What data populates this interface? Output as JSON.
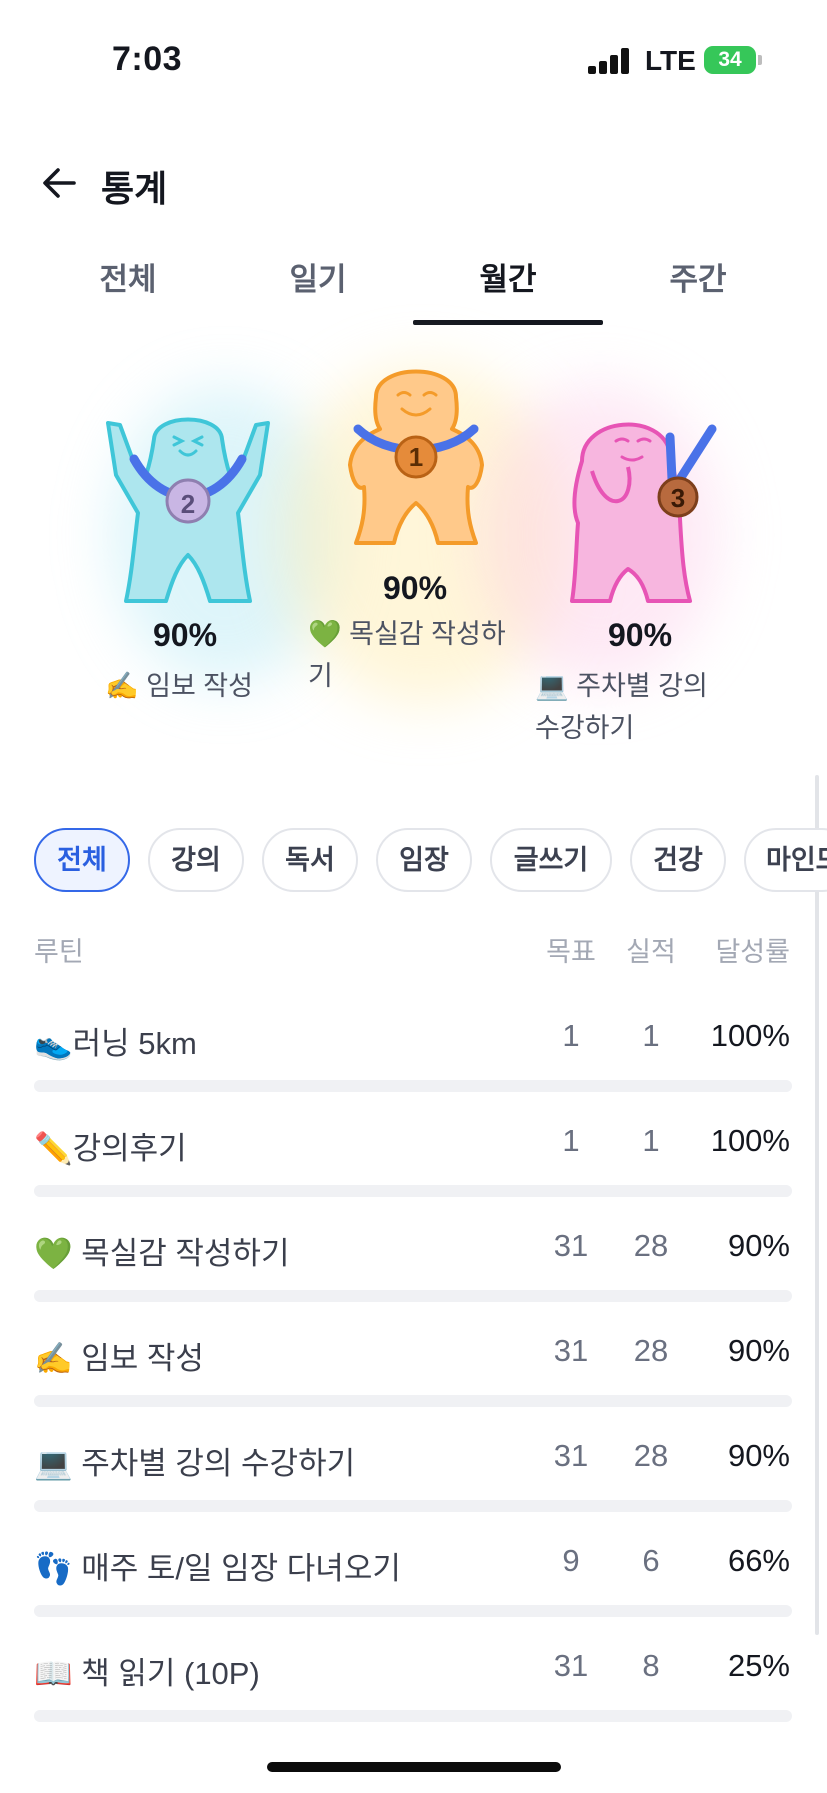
{
  "status_bar": {
    "time": "7:03",
    "network": "LTE",
    "battery": "34"
  },
  "header": {
    "title": "통계"
  },
  "tabs": [
    {
      "label": "전체",
      "active": false
    },
    {
      "label": "일기",
      "active": false
    },
    {
      "label": "월간",
      "active": true
    },
    {
      "label": "주간",
      "active": false
    }
  ],
  "podium": {
    "first": {
      "rank": "1",
      "percent": "90%",
      "label_line1": "💚 목실감 작성하",
      "label_line2": "기"
    },
    "second": {
      "rank": "2",
      "percent": "90%",
      "label_line1": "✍️ 임보 작성"
    },
    "third": {
      "rank": "3",
      "percent": "90%",
      "label_line1": "💻 주차별 강의",
      "label_line2": "수강하기"
    }
  },
  "chips": [
    "전체",
    "강의",
    "독서",
    "임장",
    "글쓰기",
    "건강",
    "마인드"
  ],
  "table": {
    "headers": {
      "routine": "루틴",
      "goal": "목표",
      "done": "실적",
      "rate": "달성률"
    },
    "rows": [
      {
        "name": "👟러닝 5km",
        "goal": "1",
        "done": "1",
        "rate": "100%",
        "progress": 1.0
      },
      {
        "name": "✏️강의후기",
        "goal": "1",
        "done": "1",
        "rate": "100%",
        "progress": 1.0
      },
      {
        "name": "💚 목실감 작성하기",
        "goal": "31",
        "done": "28",
        "rate": "90%",
        "progress": 0.9
      },
      {
        "name": "✍️ 임보 작성",
        "goal": "31",
        "done": "28",
        "rate": "90%",
        "progress": 0.9
      },
      {
        "name": "💻 주차별 강의 수강하기",
        "goal": "31",
        "done": "28",
        "rate": "90%",
        "progress": 0.9
      },
      {
        "name": "👣 매주 토/일 임장 다녀오기",
        "goal": "9",
        "done": "6",
        "rate": "66%",
        "progress": 0.66
      },
      {
        "name": "📖 책 읽기 (10P)",
        "goal": "31",
        "done": "8",
        "rate": "25%",
        "progress": 0.25
      }
    ]
  },
  "colors": {
    "accent": "#3468e8",
    "gold": "#f7a640",
    "silver": "#6dcfe0",
    "bronze": "#ee74c0",
    "medal_ribbon": "#4a72e8"
  }
}
